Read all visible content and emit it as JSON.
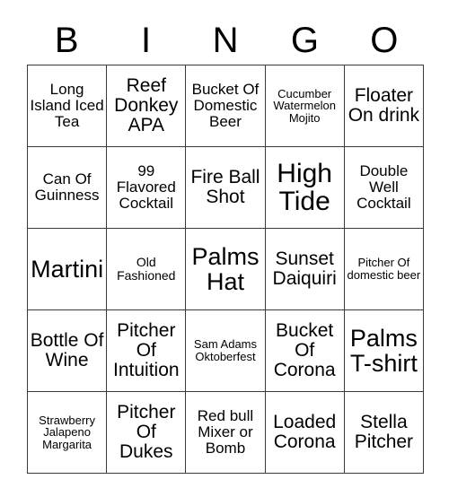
{
  "card": {
    "header_letters": [
      "B",
      "I",
      "N",
      "G",
      "O"
    ],
    "rows": [
      [
        {
          "text": "Long Island Iced Tea",
          "size": "sm"
        },
        {
          "text": "Reef Donkey APA",
          "size": "md"
        },
        {
          "text": "Bucket Of Domestic Beer",
          "size": "sm"
        },
        {
          "text": "Cucumber Watermelon Mojito",
          "size": "xxs"
        },
        {
          "text": "Floater On drink",
          "size": "md"
        }
      ],
      [
        {
          "text": "Can Of Guinness",
          "size": "sm"
        },
        {
          "text": "99 Flavored Cocktail",
          "size": "sm"
        },
        {
          "text": "Fire Ball Shot",
          "size": "md"
        },
        {
          "text": "High Tide",
          "size": "xl"
        },
        {
          "text": "Double Well Cocktail",
          "size": "sm"
        }
      ],
      [
        {
          "text": "Martini",
          "size": "lg"
        },
        {
          "text": "Old Fashioned",
          "size": "xs"
        },
        {
          "text": "Palms Hat",
          "size": "lg"
        },
        {
          "text": "Sunset Daiquiri",
          "size": "md"
        },
        {
          "text": "Pitcher Of domestic beer",
          "size": "xxs"
        }
      ],
      [
        {
          "text": "Bottle Of Wine",
          "size": "md"
        },
        {
          "text": "Pitcher Of Intuition",
          "size": "md"
        },
        {
          "text": "Sam Adams Oktoberfest",
          "size": "xxs"
        },
        {
          "text": "Bucket Of Corona",
          "size": "md"
        },
        {
          "text": "Palms T-shirt",
          "size": "lg"
        }
      ],
      [
        {
          "text": "Strawberry Jalapeno Margarita",
          "size": "xxs"
        },
        {
          "text": "Pitcher Of Dukes",
          "size": "md"
        },
        {
          "text": "Red bull Mixer or Bomb",
          "size": "sm"
        },
        {
          "text": "Loaded Corona",
          "size": "md"
        },
        {
          "text": "Stella Pitcher",
          "size": "md"
        }
      ]
    ]
  },
  "colors": {
    "background": "#ffffff",
    "text": "#000000",
    "grid_line": "#3a3a3a"
  }
}
